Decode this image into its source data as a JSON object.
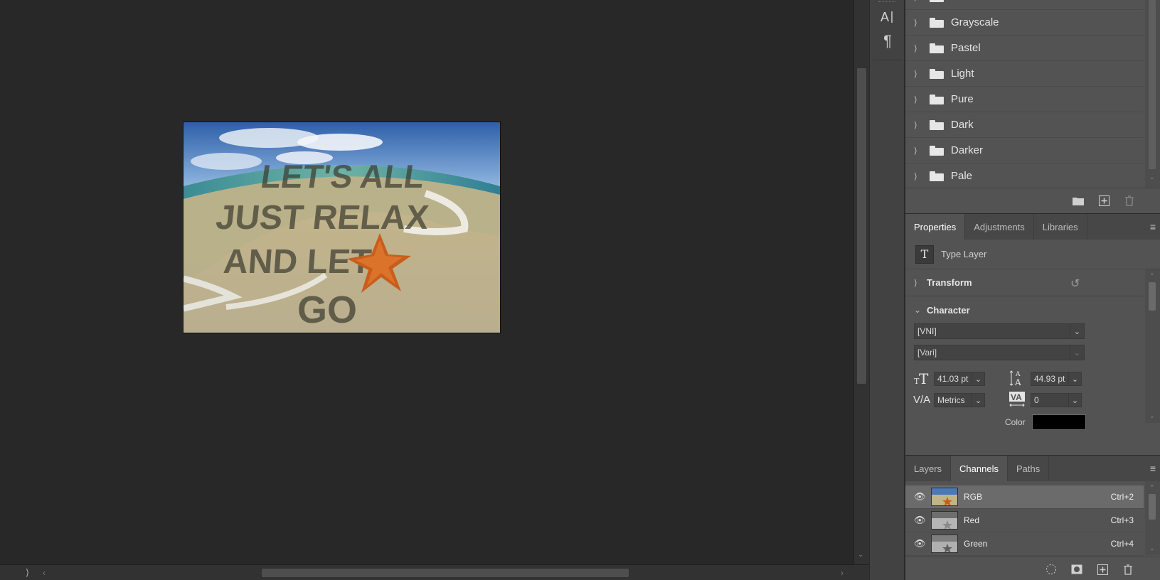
{
  "canvas": {
    "document_text": [
      "LET'S ALL",
      "JUST RELAX",
      "AND LET",
      "GO"
    ]
  },
  "swatches": {
    "folders": [
      "Grayscale",
      "Pastel",
      "Light",
      "Pure",
      "Dark",
      "Darker",
      "Pale"
    ],
    "footer_icons": [
      "new-group-icon",
      "new-swatch-icon",
      "delete-icon"
    ]
  },
  "properties": {
    "tabs": [
      "Properties",
      "Adjustments",
      "Libraries"
    ],
    "active_tab": "Properties",
    "layer_type_icon": "T",
    "layer_type": "Type Layer",
    "transform_label": "Transform",
    "character_label": "Character",
    "font_family": "[VNI]",
    "font_style": "[Vari]",
    "font_size": "41.03 pt",
    "leading": "44.93 pt",
    "kerning": "Metrics",
    "tracking": "0",
    "color_label": "Color",
    "color_value": "#000000"
  },
  "channels_panel": {
    "tabs": [
      "Layers",
      "Channels",
      "Paths"
    ],
    "active_tab": "Channels",
    "rows": [
      {
        "name": "RGB",
        "shortcut": "Ctrl+2"
      },
      {
        "name": "Red",
        "shortcut": "Ctrl+3"
      },
      {
        "name": "Green",
        "shortcut": "Ctrl+4"
      }
    ]
  },
  "colors": {
    "canvas_bg": "#282828",
    "panel_bg": "#535353",
    "selected_row": "#6b6b6b"
  }
}
